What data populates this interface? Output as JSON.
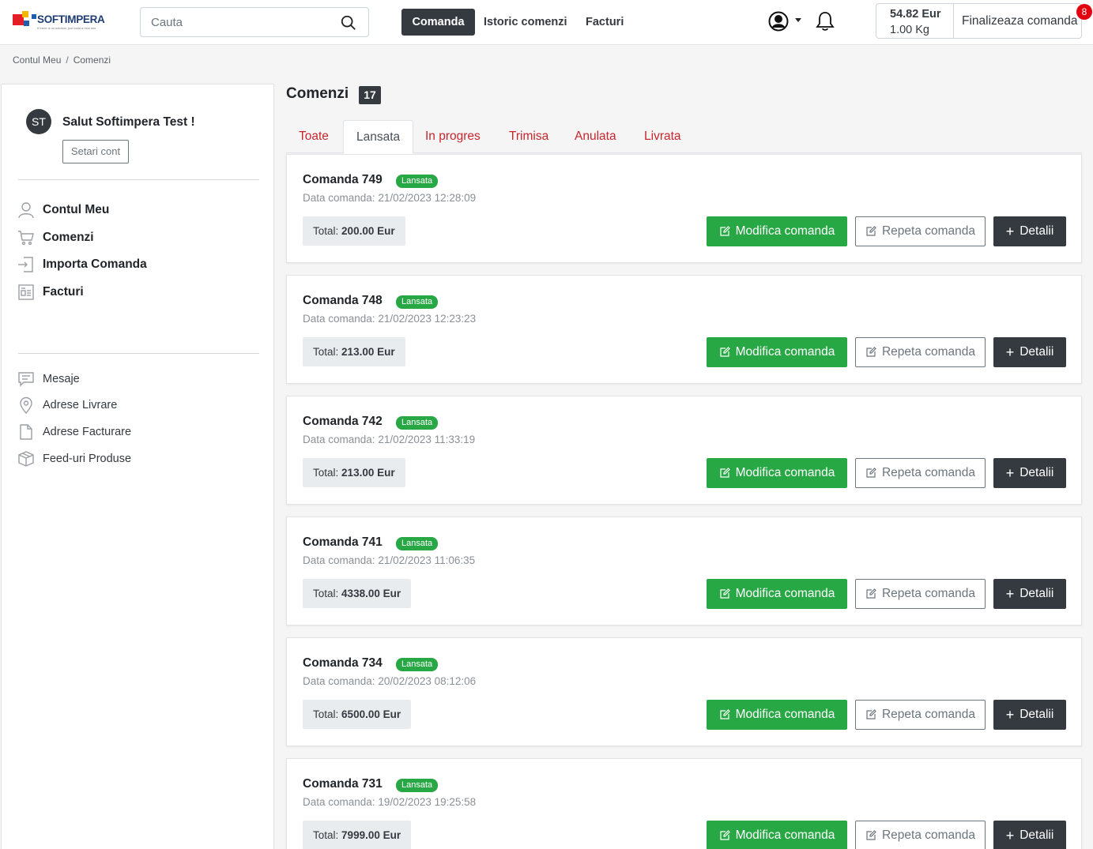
{
  "header": {
    "logo_text": "SOFTIMPERA",
    "logo_tagline": "If there is no solution, just build a new one",
    "search_placeholder": "Cauta",
    "nav": {
      "comanda": "Comanda",
      "istoric": "Istoric comenzi",
      "facturi": "Facturi"
    },
    "cart": {
      "total": "54.82 Eur",
      "weight": "1.00 Kg",
      "finalize_label": "Finalizeaza comanda",
      "badge_count": "8"
    }
  },
  "breadcrumb": {
    "home": "Contul Meu",
    "separator": "/",
    "current": "Comenzi"
  },
  "sidebar": {
    "avatar_initials": "ST",
    "greeting": "Salut Softimpera Test !",
    "settings_label": "Setari cont",
    "primary_menu": [
      {
        "label": "Contul Meu",
        "icon": "user-icon"
      },
      {
        "label": "Comenzi",
        "icon": "cart-icon"
      },
      {
        "label": "Importa Comanda",
        "icon": "import-icon"
      },
      {
        "label": "Facturi",
        "icon": "invoice-icon"
      }
    ],
    "secondary_menu": [
      {
        "label": "Mesaje",
        "icon": "message-icon"
      },
      {
        "label": "Adrese Livrare",
        "icon": "location-pin-icon"
      },
      {
        "label": "Adrese Facturare",
        "icon": "document-icon"
      },
      {
        "label": "Feed-uri Produse",
        "icon": "box-icon"
      }
    ]
  },
  "main": {
    "title": "Comenzi",
    "count": "17",
    "tabs": [
      "Toate",
      "Lansata",
      "In progres",
      "Trimisa",
      "Anulata",
      "Livrata"
    ],
    "active_tab": "Lansata",
    "date_prefix": "Data comanda:",
    "total_prefix": "Total:",
    "buttons": {
      "modify": "Modifica comanda",
      "repeat": "Repeta comanda",
      "details": "Detalii"
    },
    "orders": [
      {
        "title": "Comanda 749",
        "status": "Lansata",
        "date": "21/02/2023 12:28:09",
        "total": "200.00 Eur"
      },
      {
        "title": "Comanda 748",
        "status": "Lansata",
        "date": "21/02/2023 12:23:23",
        "total": "213.00 Eur"
      },
      {
        "title": "Comanda 742",
        "status": "Lansata",
        "date": "21/02/2023 11:33:19",
        "total": "213.00 Eur"
      },
      {
        "title": "Comanda 741",
        "status": "Lansata",
        "date": "21/02/2023 11:06:35",
        "total": "4338.00 Eur"
      },
      {
        "title": "Comanda 734",
        "status": "Lansata",
        "date": "20/02/2023 08:12:06",
        "total": "6500.00 Eur"
      },
      {
        "title": "Comanda 731",
        "status": "Lansata",
        "date": "19/02/2023 19:25:58",
        "total": "7999.00 Eur"
      }
    ]
  },
  "colors": {
    "accent_dark": "#343a40",
    "success": "#28a745",
    "tab_link": "#c8262d",
    "badge_red": "#e3000f"
  }
}
